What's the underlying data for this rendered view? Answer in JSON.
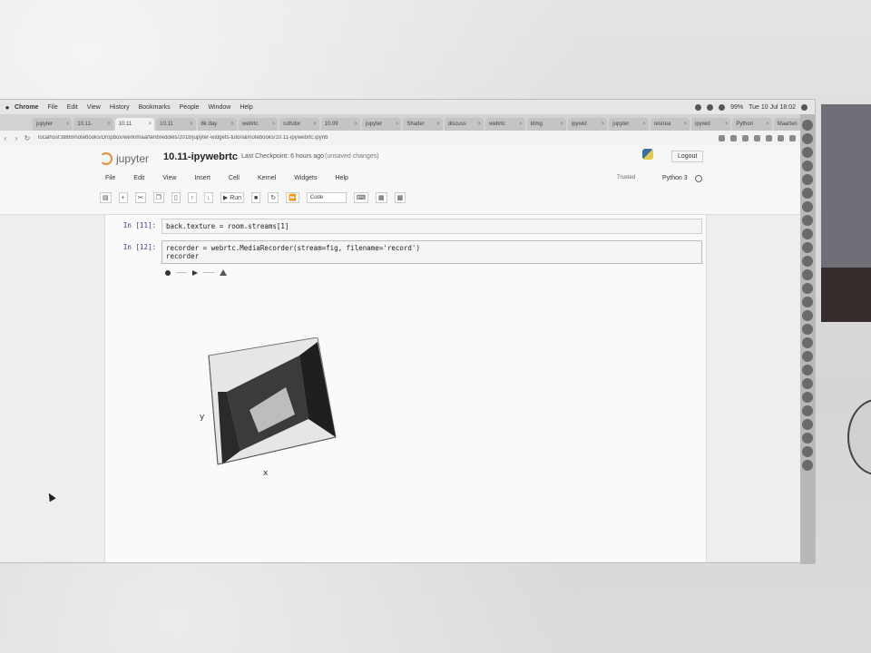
{
  "menubar": {
    "app": "Chrome",
    "items": [
      "File",
      "Edit",
      "View",
      "History",
      "Bookmarks",
      "People",
      "Window",
      "Help"
    ],
    "clock": "Tue 10 Jul 18:02",
    "battery": "99%"
  },
  "tabs": [
    "jupyter",
    "10.11-",
    "10.11",
    "10.11",
    "8k day",
    "webrtc",
    "ruthdor",
    "10.09",
    "jupyter",
    "Shader",
    "discuss",
    "webrtc",
    "Idmg",
    "ipywid",
    "jupyter",
    "restrea",
    "ipywid",
    "Python",
    "Maarten"
  ],
  "active_tab": 2,
  "address": {
    "url": "localhost:8888/notebooks/Dropbox/werk/maartenbreddels/2018/jupyter-widgets-tutorial/notebooks/10.11-ipywebrtc.ipynb"
  },
  "jupyter": {
    "logo_text": "jupyter",
    "notebook_title": "10.11-ipywebrtc",
    "checkpoint": "Last Checkpoint: 6 hours ago",
    "unsaved": "(unsaved changes)",
    "logout": "Logout",
    "menu": [
      "File",
      "Edit",
      "View",
      "Insert",
      "Cell",
      "Kernel",
      "Widgets",
      "Help"
    ],
    "trusted": "Trusted",
    "kernel": "Python 3",
    "toolbar": {
      "run_label": "Run",
      "cell_type": "Code"
    }
  },
  "cells": [
    {
      "prompt": "In [11]:",
      "code": "back.texture = room.streams[1]"
    },
    {
      "prompt": "In [12]:",
      "code": "recorder = webrtc.MediaRecorder(stream=fig, filename='record')\nrecorder"
    }
  ],
  "figure": {
    "axis_x": "x",
    "axis_y": "y"
  }
}
